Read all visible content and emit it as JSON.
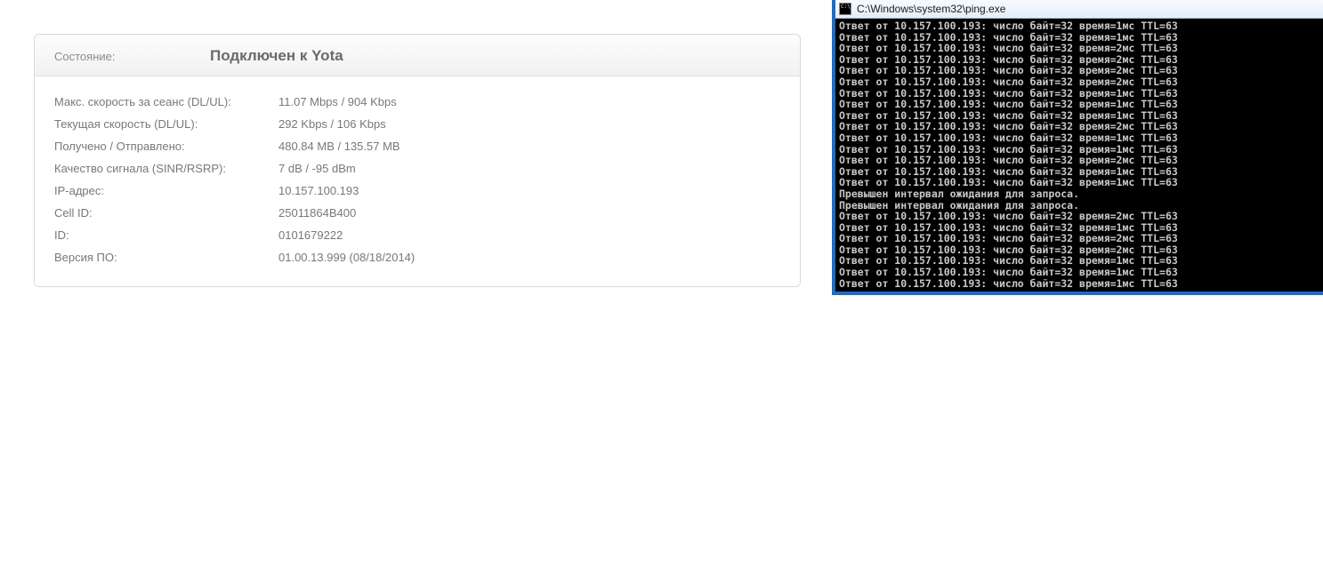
{
  "status_panel": {
    "header": {
      "label": "Состояние:",
      "value": "Подключен к Yota"
    },
    "rows": [
      {
        "label": "Макс. скорость за сеанс (DL/UL):",
        "value": "11.07 Mbps / 904 Kbps"
      },
      {
        "label": "Текущая скорость (DL/UL):",
        "value": "292 Kbps / 106 Kbps"
      },
      {
        "label": "Получено / Отправлено:",
        "value": "480.84 MB / 135.57 MB"
      },
      {
        "label": "Качество сигнала (SINR/RSRP):",
        "value": "7 dB / -95 dBm"
      },
      {
        "label": "IP-адрес:",
        "value": "10.157.100.193"
      },
      {
        "label": "Cell ID:",
        "value": "25011864B400"
      },
      {
        "label": "ID:",
        "value": "0101679222"
      },
      {
        "label": "Версия ПО:",
        "value": "01.00.13.999 (08/18/2014)"
      }
    ]
  },
  "cmd_window": {
    "title": "C:\\Windows\\system32\\ping.exe",
    "lines": [
      "Ответ от 10.157.100.193: число байт=32 время=1мс TTL=63",
      "Ответ от 10.157.100.193: число байт=32 время=1мс TTL=63",
      "Ответ от 10.157.100.193: число байт=32 время=2мс TTL=63",
      "Ответ от 10.157.100.193: число байт=32 время=2мс TTL=63",
      "Ответ от 10.157.100.193: число байт=32 время=2мс TTL=63",
      "Ответ от 10.157.100.193: число байт=32 время=2мс TTL=63",
      "Ответ от 10.157.100.193: число байт=32 время=1мс TTL=63",
      "Ответ от 10.157.100.193: число байт=32 время=1мс TTL=63",
      "Ответ от 10.157.100.193: число байт=32 время=1мс TTL=63",
      "Ответ от 10.157.100.193: число байт=32 время=2мс TTL=63",
      "Ответ от 10.157.100.193: число байт=32 время=1мс TTL=63",
      "Ответ от 10.157.100.193: число байт=32 время=1мс TTL=63",
      "Ответ от 10.157.100.193: число байт=32 время=2мс TTL=63",
      "Ответ от 10.157.100.193: число байт=32 время=1мс TTL=63",
      "Ответ от 10.157.100.193: число байт=32 время=1мс TTL=63",
      "Превышен интервал ожидания для запроса.",
      "Превышен интервал ожидания для запроса.",
      "Ответ от 10.157.100.193: число байт=32 время=2мс TTL=63",
      "Ответ от 10.157.100.193: число байт=32 время=1мс TTL=63",
      "Ответ от 10.157.100.193: число байт=32 время=2мс TTL=63",
      "Ответ от 10.157.100.193: число байт=32 время=2мс TTL=63",
      "Ответ от 10.157.100.193: число байт=32 время=1мс TTL=63",
      "Ответ от 10.157.100.193: число байт=32 время=1мс TTL=63",
      "Ответ от 10.157.100.193: число байт=32 время=1мс TTL=63"
    ]
  }
}
